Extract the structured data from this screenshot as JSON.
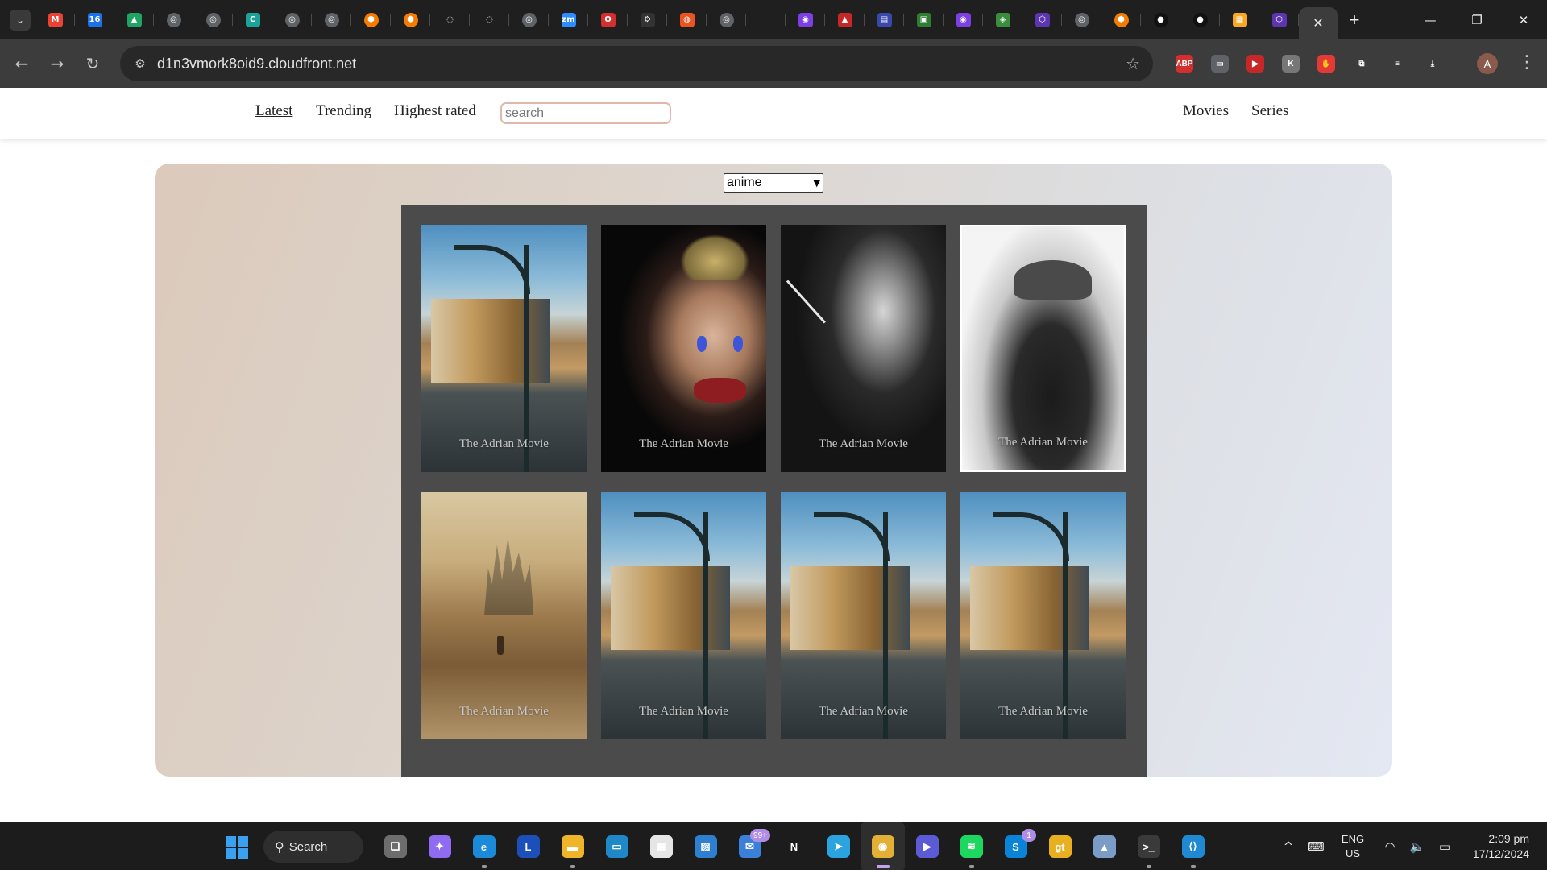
{
  "browser": {
    "tabs": [
      {
        "icon": "gmail-icon",
        "color": "#ea4335",
        "glyph": "M"
      },
      {
        "icon": "calendar-icon",
        "color": "#1a73e8",
        "glyph": "16"
      },
      {
        "icon": "drive-icon",
        "color": "#1fa463",
        "glyph": "▲"
      },
      {
        "icon": "globe-icon",
        "color": "#5f6368",
        "glyph": "◎"
      },
      {
        "icon": "globe-icon",
        "color": "#5f6368",
        "glyph": "◎"
      },
      {
        "icon": "c-app-icon",
        "color": "#1aa39a",
        "glyph": "C"
      },
      {
        "icon": "globe-icon",
        "color": "#5f6368",
        "glyph": "◎"
      },
      {
        "icon": "globe-icon",
        "color": "#5f6368",
        "glyph": "◎"
      },
      {
        "icon": "hexagon-orange-icon",
        "color": "#f57c00",
        "glyph": "⬢"
      },
      {
        "icon": "hexagon-orange-icon",
        "color": "#f57c00",
        "glyph": "⬢"
      },
      {
        "icon": "loading-spinner-icon",
        "color": "#1f1f1f",
        "glyph": "◌"
      },
      {
        "icon": "loading-spinner-icon",
        "color": "#1f1f1f",
        "glyph": "◌"
      },
      {
        "icon": "globe-icon",
        "color": "#5f6368",
        "glyph": "◎"
      },
      {
        "icon": "zoom-icon",
        "color": "#2d8cff",
        "glyph": "zm"
      },
      {
        "icon": "opera-icon",
        "color": "#d32f2f",
        "glyph": "O"
      },
      {
        "icon": "openai-icon",
        "color": "#333333",
        "glyph": "⚙"
      },
      {
        "icon": "ubuntu-icon",
        "color": "#e95420",
        "glyph": "◍"
      },
      {
        "icon": "globe-icon",
        "color": "#5f6368",
        "glyph": "◎"
      },
      {
        "icon": "blank-icon",
        "color": "#1f1f1f",
        "glyph": ""
      },
      {
        "icon": "purple-app-icon",
        "color": "#7b3fe4",
        "glyph": "◉"
      },
      {
        "icon": "red-triangle-icon",
        "color": "#c62828",
        "glyph": "▲"
      },
      {
        "icon": "blue-box-icon",
        "color": "#3949ab",
        "glyph": "▤"
      },
      {
        "icon": "green-box-icon",
        "color": "#2e7d32",
        "glyph": "▣"
      },
      {
        "icon": "purple-app-icon",
        "color": "#7b3fe4",
        "glyph": "◉"
      },
      {
        "icon": "green-app-icon",
        "color": "#388e3c",
        "glyph": "◈"
      },
      {
        "icon": "cube-icon",
        "color": "#5e35b1",
        "glyph": "⬡"
      },
      {
        "icon": "globe-icon",
        "color": "#5f6368",
        "glyph": "◎"
      },
      {
        "icon": "hexagon-orange-icon",
        "color": "#f57c00",
        "glyph": "⬢"
      },
      {
        "icon": "github-icon",
        "color": "#111111",
        "glyph": "●"
      },
      {
        "icon": "github-icon",
        "color": "#111111",
        "glyph": "●"
      },
      {
        "icon": "yellow-box-icon",
        "color": "#f9a825",
        "glyph": "▦"
      },
      {
        "icon": "cube-icon",
        "color": "#5e35b1",
        "glyph": "⬡"
      }
    ],
    "active_tab_close": "✕",
    "new_tab": "+",
    "window_controls": {
      "minimize": "—",
      "restore": "❐",
      "close": "✕"
    },
    "url": "d1n3vmork8oid9.cloudfront.net",
    "nav": {
      "back": "←",
      "forward": "→",
      "reload": "↻",
      "site_info": "⚙",
      "bookmark": "☆"
    },
    "extensions": [
      {
        "icon": "adblock-icon",
        "color": "#d32f2f",
        "glyph": "ABP"
      },
      {
        "icon": "printer-icon",
        "color": "#5f6368",
        "glyph": "▭"
      },
      {
        "icon": "video-ext-icon",
        "color": "#c62828",
        "glyph": "▶"
      },
      {
        "icon": "grey-ext-icon",
        "color": "#777777",
        "glyph": "K"
      },
      {
        "icon": "hand-ext-icon",
        "color": "#e53935",
        "glyph": "✋"
      },
      {
        "icon": "puzzle-icon",
        "color": "#3c3c3c",
        "glyph": "⧉"
      },
      {
        "icon": "reading-list-icon",
        "color": "#3c3c3c",
        "glyph": "≡"
      },
      {
        "icon": "download-icon",
        "color": "#3c3c3c",
        "glyph": "⤓"
      }
    ],
    "profile_initial": "A",
    "menu": "⋮"
  },
  "site": {
    "nav": {
      "latest": "Latest",
      "trending": "Trending",
      "highest_rated": "Highest rated",
      "search_placeholder": "search",
      "movies": "Movies",
      "series": "Series"
    },
    "genre_selected": "anime",
    "genre_chevron": "▼",
    "movies": [
      {
        "title": "The Adrian Movie",
        "art": "street"
      },
      {
        "title": "The Adrian Movie",
        "art": "joker"
      },
      {
        "title": "The Adrian Movie",
        "art": "noir"
      },
      {
        "title": "The Adrian Movie",
        "art": "hat"
      },
      {
        "title": "The Adrian Movie",
        "art": "desert"
      },
      {
        "title": "The Adrian Movie",
        "art": "street"
      },
      {
        "title": "The Adrian Movie",
        "art": "street"
      },
      {
        "title": "The Adrian Movie",
        "art": "street"
      }
    ]
  },
  "taskbar": {
    "search_label": "Search",
    "search_glyph": "⚲",
    "apps": [
      {
        "icon": "task-view-icon",
        "color": "#6d6d6d",
        "glyph": "❑",
        "running": false
      },
      {
        "icon": "copilot-icon",
        "color": "#8e6bf0",
        "glyph": "✦",
        "running": false
      },
      {
        "icon": "edge-icon",
        "color": "#1b8ad8",
        "glyph": "e",
        "running": true
      },
      {
        "icon": "l-app-icon",
        "color": "#1d4fb8",
        "glyph": "L",
        "running": false
      },
      {
        "icon": "file-explorer-icon",
        "color": "#f0b429",
        "glyph": "▬",
        "running": true
      },
      {
        "icon": "desktop-icon",
        "color": "#1e88c8",
        "glyph": "▭",
        "running": false
      },
      {
        "icon": "store-icon",
        "color": "#e6e6e6",
        "glyph": "▦",
        "running": false
      },
      {
        "icon": "photos-icon",
        "color": "#2f7fd0",
        "glyph": "▨",
        "running": false
      },
      {
        "icon": "mail-icon",
        "color": "#3b7fd9",
        "glyph": "✉",
        "running": false,
        "badge": "99+"
      },
      {
        "icon": "netflix-icon",
        "color": "#1c1c1c",
        "glyph": "N",
        "running": false
      },
      {
        "icon": "telegram-icon",
        "color": "#2aa3de",
        "glyph": "➤",
        "running": false
      },
      {
        "icon": "chrome-icon",
        "color": "#e2b034",
        "glyph": "◉",
        "running": true,
        "active": true
      },
      {
        "icon": "media-player-icon",
        "color": "#5b5bd6",
        "glyph": "▶",
        "running": false
      },
      {
        "icon": "spotify-icon",
        "color": "#1ed760",
        "glyph": "≋",
        "running": true
      },
      {
        "icon": "skype-icon",
        "color": "#0a84d8",
        "glyph": "S",
        "running": false,
        "badge": "1"
      },
      {
        "icon": "gt-app-icon",
        "color": "#e8b020",
        "glyph": "gt",
        "running": false
      },
      {
        "icon": "paint-icon",
        "color": "#7a9cc6",
        "glyph": "▲",
        "running": false
      },
      {
        "icon": "terminal-icon",
        "color": "#3a3a3a",
        "glyph": ">_",
        "running": true
      },
      {
        "icon": "vscode-icon",
        "color": "#1f8ad2",
        "glyph": "⟨⟩",
        "running": true
      }
    ],
    "tray": {
      "chevron": "^",
      "keyboard": "⌨",
      "lang_top": "ENG",
      "lang_bottom": "US",
      "wifi": "◠",
      "volume": "🔈",
      "battery": "▭",
      "time": "2:09 pm",
      "date": "17/12/2024"
    }
  }
}
